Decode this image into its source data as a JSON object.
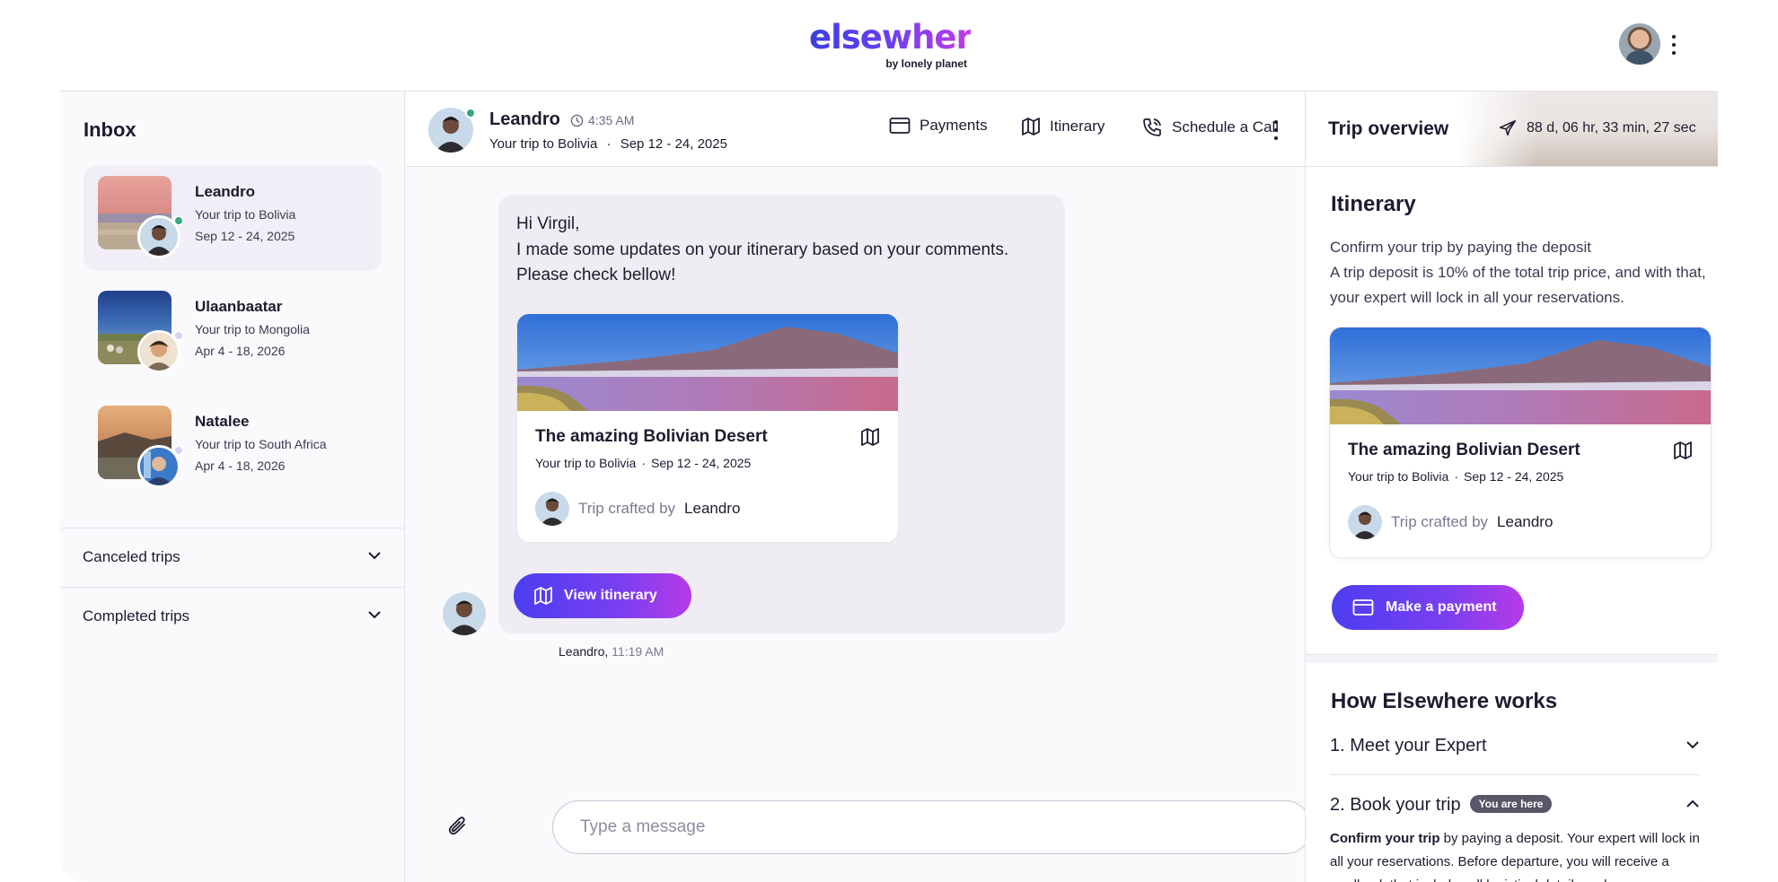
{
  "header": {
    "logo_word": "elsewhere",
    "logo_sub": "by lonely planet"
  },
  "inbox": {
    "title": "Inbox",
    "conversations": [
      {
        "name": "Leandro",
        "subtitle": "Your trip to Bolivia",
        "dates": "Sep 12 - 24, 2025",
        "status_color": "#3aa682"
      },
      {
        "name": "Ulaanbaatar",
        "subtitle": "Your trip to Mongolia",
        "dates": "Apr 4 - 18, 2026",
        "status_color": "#d9d2f2"
      },
      {
        "name": "Natalee",
        "subtitle": "Your trip to South Africa",
        "dates": "Apr 4 - 18, 2026",
        "status_color": "#d9d2f2"
      }
    ],
    "canceled_label": "Canceled trips",
    "completed_label": "Completed trips"
  },
  "chat": {
    "contact_name": "Leandro",
    "time": "4:35 AM",
    "trip_line": "Your trip to Bolivia",
    "trip_dates": "Sep 12 - 24, 2025",
    "payments_label": "Payments",
    "itinerary_label": "Itinerary",
    "call_label": "Schedule a Call",
    "message": {
      "greeting": "Hi Virgil,",
      "line1": "I made some updates on your itinerary based on your comments.",
      "line2": "Please check bellow!",
      "card_title": "The amazing Bolivian Desert",
      "card_trip": "Your trip to Bolivia",
      "card_dates": "Sep 12 - 24, 2025",
      "crafted_by": "Trip crafted by",
      "crafted_name": "Leandro",
      "button_label": "View itinerary",
      "sender": "Leandro,",
      "sent_time": "11:19 AM"
    },
    "composer_placeholder": "Type a message"
  },
  "overview": {
    "title": "Trip overview",
    "countdown": "88 d, 06 hr, 33 min, 27 sec",
    "itinerary_title": "Itinerary",
    "confirm_line": "Confirm your trip by paying the deposit",
    "deposit_text": "A trip deposit is 10% of the total trip price, and with that, your expert will lock in all your reservations.",
    "card_title": "The amazing Bolivian Desert",
    "card_trip": "Your trip to Bolivia",
    "card_dates": "Sep 12 - 24, 2025",
    "crafted_by": "Trip crafted by",
    "crafted_name": "Leandro",
    "pay_button": "Make a payment",
    "how_title": "How Elsewhere works",
    "step1": "1. Meet your Expert",
    "step2": "2. Book your trip",
    "step2_badge": "You are here",
    "step2_bold": "Confirm your trip",
    "step2_body": " by paying a deposit. Your expert will lock in all your reservations. Before departure, you will receive a roadbook that includes all logistical details and"
  },
  "colors": {
    "brand_start": "#3b3fe0",
    "brand_end": "#c23be8",
    "online": "#3aa682"
  }
}
